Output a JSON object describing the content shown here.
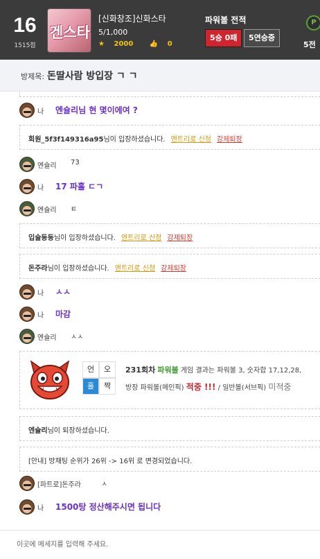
{
  "header": {
    "rank": "16",
    "rank_score": "1515점",
    "room_name": "[신화창조]신화스타",
    "member_count": "5/1,000",
    "stars": "2000",
    "likes": "0",
    "record_title": "파워볼 전적",
    "record_wl": "5승 0패",
    "record_streak": "5연승중",
    "p_badge": "P",
    "p_count": "5전",
    "thumb_text": "겐스타"
  },
  "title_bar": {
    "label": "방제목:",
    "title": "돈딸사람 방입장 ㄱ ㄱ"
  },
  "messages": {
    "m1": {
      "sender": "나",
      "text": "엔슐리님 현 몇이에여 ?"
    },
    "s1": {
      "user": "회원_5f3f149316a95",
      "suffix": "님이 입장하셨습니다.",
      "entry": "엔트리로 신청",
      "kick": "강제퇴장"
    },
    "m2": {
      "sender": "엔슐리",
      "text": "73"
    },
    "m3": {
      "sender": "나",
      "text": "17 파홀 ㄷㄱ"
    },
    "m4": {
      "sender": "엔슐리",
      "text": "ㅌ"
    },
    "s2": {
      "user": "입술둥둥",
      "suffix": "님이 입장하셨습니다.",
      "entry": "엔트리로 신청",
      "kick": "강제퇴장"
    },
    "s3": {
      "user": "돈주라",
      "suffix": "님이 입장하셨습니다.",
      "entry": "엔트리로 신청",
      "kick": "강제퇴장"
    },
    "m5": {
      "sender": "나",
      "text": "ㅅㅅ"
    },
    "m6": {
      "sender": "나",
      "text": "마감"
    },
    "m7": {
      "sender": "엔슐리",
      "text": "ㅅㅅ"
    },
    "game": {
      "odd_label": "언",
      "even_label": "오",
      "hole_label": "홀",
      "jjak_label": "짝",
      "round": "231회차",
      "game_name": "파워볼",
      "result_text": "게임 결과는 파워볼 3, 숫자합 17,12,28,",
      "line2_prefix": "방장 파워볼(메인픽)",
      "hit": "적중 !!!",
      "line2_mid": "/ 일반볼(서브픽)",
      "miss": "미적중"
    },
    "s4": {
      "user": "엔슐리",
      "suffix": "님이 퇴장하셨습니다."
    },
    "s5": {
      "text": "[안내] 방채팅 순위가 26위 -> 16위 로 변경되었습니다."
    },
    "m8": {
      "sender": "[파트로]돈주라",
      "text": "ㅅ"
    },
    "m9": {
      "sender": "나",
      "text": "1500탕 정산해주시면 됩니다"
    }
  },
  "input": {
    "placeholder": "이곳에 메세지를 입력해 주세요."
  }
}
